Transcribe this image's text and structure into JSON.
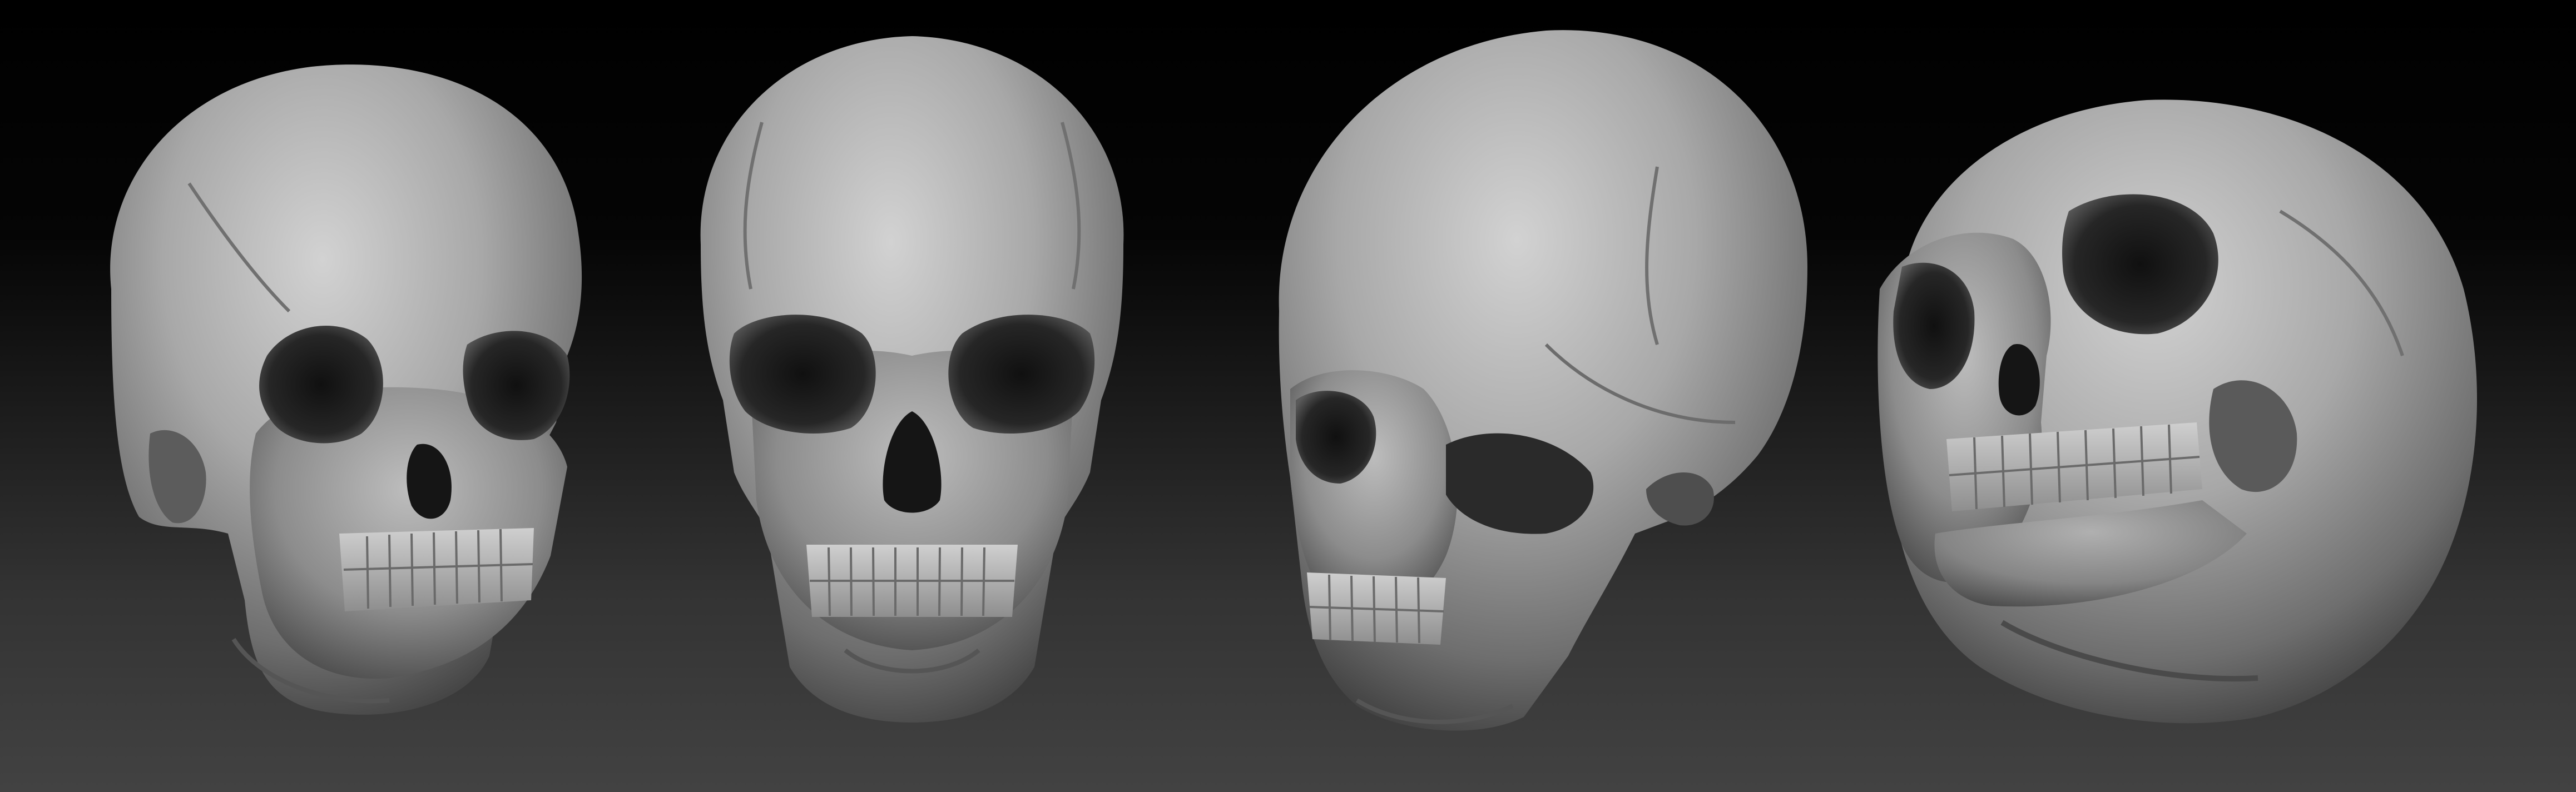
{
  "scene": {
    "subject": "skull-sculpt-views",
    "views": [
      {
        "name": "three-quarter-left",
        "orientation": "three-quarter"
      },
      {
        "name": "front",
        "orientation": "front"
      },
      {
        "name": "profile-side",
        "orientation": "side"
      },
      {
        "name": "tilted-three-quarter",
        "orientation": "tilted"
      }
    ],
    "colors": {
      "background_top": "#000000",
      "background_bottom": "#424242",
      "bone_light": "#c2c2c2",
      "bone_mid": "#8a8a8a",
      "bone_dark": "#3a3a3a",
      "cavity": "#181818"
    }
  }
}
